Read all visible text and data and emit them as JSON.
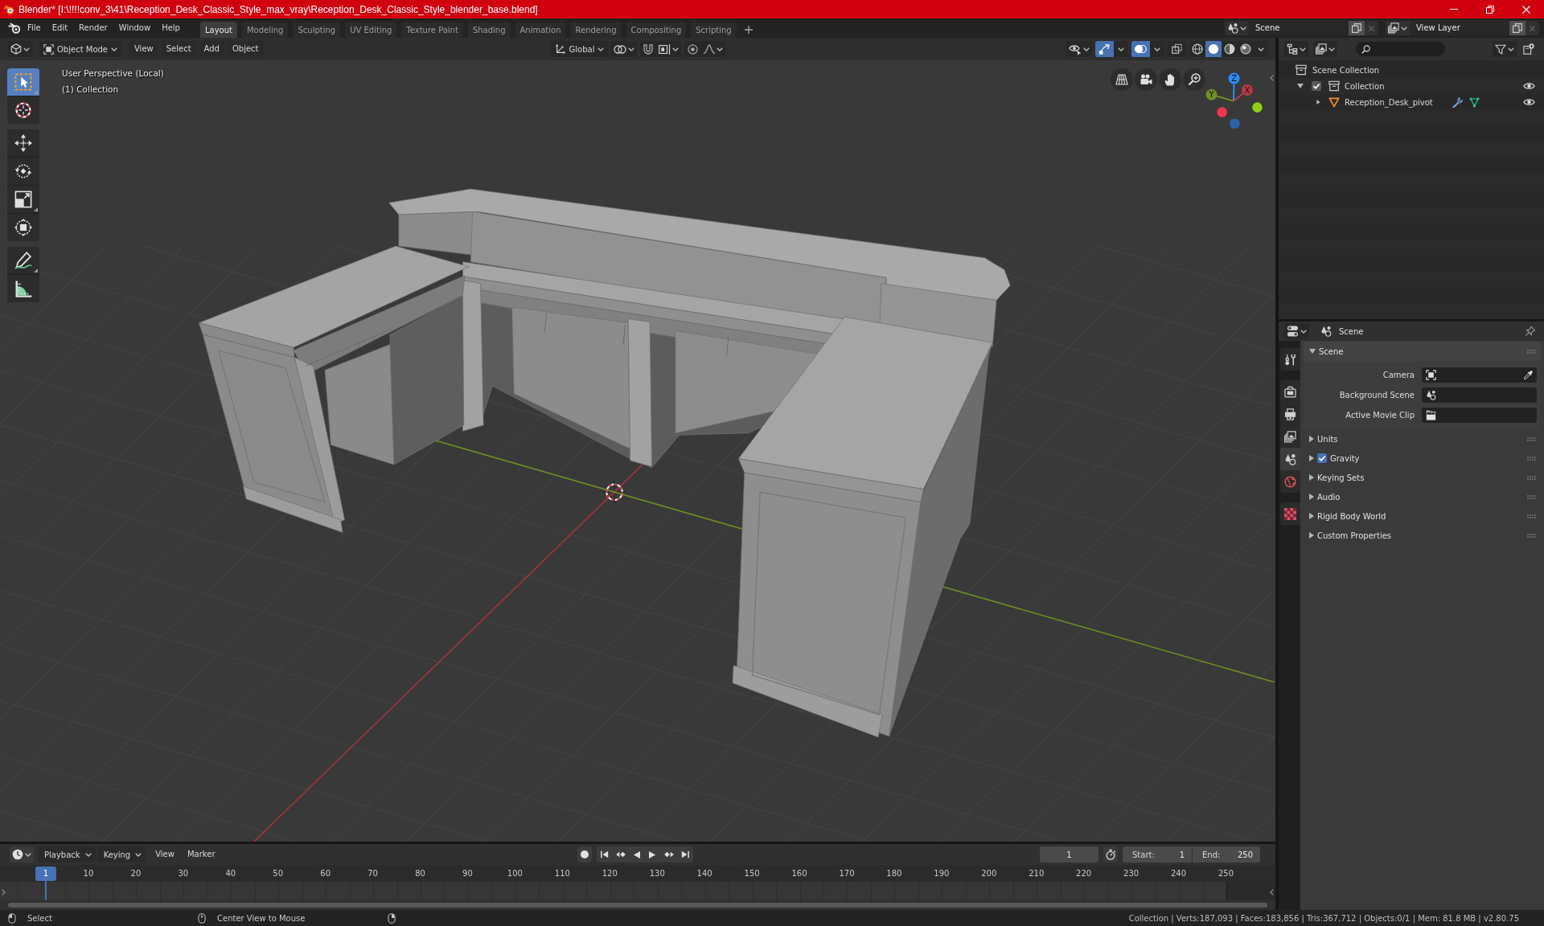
{
  "window": {
    "title": "Blender* [I:\\!!!!conv_3\\41\\Reception_Desk_Classic_Style_max_vray\\Reception_Desk_Classic_Style_blender_base.blend]"
  },
  "menu": [
    "File",
    "Edit",
    "Render",
    "Window",
    "Help"
  ],
  "workspace_tabs": [
    {
      "label": "Layout",
      "selected": true
    },
    {
      "label": "Modeling",
      "selected": false
    },
    {
      "label": "Sculpting",
      "selected": false
    },
    {
      "label": "UV Editing",
      "selected": false
    },
    {
      "label": "Texture Paint",
      "selected": false
    },
    {
      "label": "Shading",
      "selected": false
    },
    {
      "label": "Animation",
      "selected": false
    },
    {
      "label": "Rendering",
      "selected": false
    },
    {
      "label": "Compositing",
      "selected": false
    },
    {
      "label": "Scripting",
      "selected": false
    }
  ],
  "scene_selector": {
    "value": "Scene"
  },
  "view_layer_selector": {
    "value": "View Layer"
  },
  "viewport_header": {
    "mode": "Object Mode",
    "menus": [
      "View",
      "Select",
      "Add",
      "Object"
    ],
    "orientation": "Global",
    "snap": {
      "on": false
    },
    "proportional_editing": {
      "on": false
    },
    "toggles": [
      {
        "kind": "gizmos",
        "on": true
      },
      {
        "kind": "overlays",
        "on": true
      },
      {
        "kind": "xray",
        "on": false
      }
    ],
    "shading": [
      {
        "kind": "wireframe",
        "selected": false
      },
      {
        "kind": "solid",
        "selected": true
      },
      {
        "kind": "material",
        "selected": false
      },
      {
        "kind": "rendered",
        "selected": false
      }
    ]
  },
  "toolbar": [
    {
      "tools": [
        {
          "kind": "select",
          "selected": true
        },
        {
          "kind": "cursor",
          "selected": false
        }
      ]
    },
    {
      "tools": [
        {
          "kind": "move",
          "selected": false
        },
        {
          "kind": "rotate",
          "selected": false
        },
        {
          "kind": "scale",
          "selected": false
        },
        {
          "kind": "transform",
          "selected": false
        }
      ]
    },
    {
      "tools": [
        {
          "kind": "annotate",
          "selected": false
        },
        {
          "kind": "measure",
          "selected": false
        }
      ]
    }
  ],
  "viewport": {
    "view_name": "User Perspective (Local)",
    "collection": "(1) Collection",
    "gizmo": [
      {
        "kind": "z",
        "label": "Z"
      },
      {
        "kind": "x",
        "label": "X"
      },
      {
        "kind": "y",
        "label": "Y"
      }
    ]
  },
  "timeline": {
    "menus": [
      {
        "kind": "dropdown",
        "label": "Playback"
      },
      {
        "kind": "dropdown",
        "label": "Keying"
      },
      {
        "kind": "menu",
        "label": "View"
      },
      {
        "kind": "menu",
        "label": "Marker"
      }
    ],
    "current_frame": "1",
    "start": {
      "label": "Start:",
      "value": "1"
    },
    "end": {
      "label": "End:",
      "value": "250"
    },
    "playhead": "1",
    "ticks": [
      "10",
      "20",
      "30",
      "40",
      "50",
      "60",
      "70",
      "80",
      "90",
      "100",
      "110",
      "120",
      "130",
      "140",
      "150",
      "160",
      "170",
      "180",
      "190",
      "200",
      "210",
      "220",
      "230",
      "240",
      "250"
    ]
  },
  "outliner": {
    "root": "Scene Collection",
    "items": [
      {
        "kind": "collection",
        "label": "Collection",
        "checked": true,
        "expanded": true,
        "children": [
          {
            "kind": "mesh",
            "label": "Reception_Desk_pivot",
            "expanded": false
          }
        ]
      }
    ]
  },
  "properties": {
    "context": "Scene",
    "tab_groups": [
      {
        "tabs": [
          {
            "kind": "tool",
            "selected": false
          }
        ]
      },
      {
        "tabs": [
          {
            "kind": "render",
            "selected": false
          },
          {
            "kind": "output",
            "selected": false
          },
          {
            "kind": "view_layer",
            "selected": false
          },
          {
            "kind": "scene",
            "selected": true
          },
          {
            "kind": "world",
            "selected": false
          }
        ]
      },
      {
        "tabs": [
          {
            "kind": "texture",
            "selected": false
          }
        ]
      }
    ],
    "panels": [
      {
        "kind": "plain",
        "label": "Scene",
        "expanded": true,
        "fields": [
          {
            "kind": "camera",
            "label": "Camera"
          },
          {
            "kind": "scene",
            "label": "Background Scene"
          },
          {
            "kind": "clip",
            "label": "Active Movie Clip"
          }
        ]
      },
      {
        "kind": "plain",
        "label": "Units",
        "expanded": false
      },
      {
        "kind": "toggle",
        "label": "Gravity",
        "checked": true,
        "expanded": false
      },
      {
        "kind": "plain",
        "label": "Keying Sets",
        "expanded": false
      },
      {
        "kind": "plain",
        "label": "Audio",
        "expanded": false
      },
      {
        "kind": "plain",
        "label": "Rigid Body World",
        "expanded": false
      },
      {
        "kind": "plain",
        "label": "Custom Properties",
        "expanded": false
      }
    ]
  },
  "status_bar": {
    "hints": [
      {
        "kind": "left",
        "label": "Select"
      },
      {
        "kind": "middle",
        "label": "Center View to Mouse"
      },
      {
        "kind": "right"
      }
    ],
    "stats": "Collection | Verts:187,093 | Faces:183,856 | Tris:367,712 | Objects:0/1 | Mem: 81.8 MB | v2.80.75"
  }
}
